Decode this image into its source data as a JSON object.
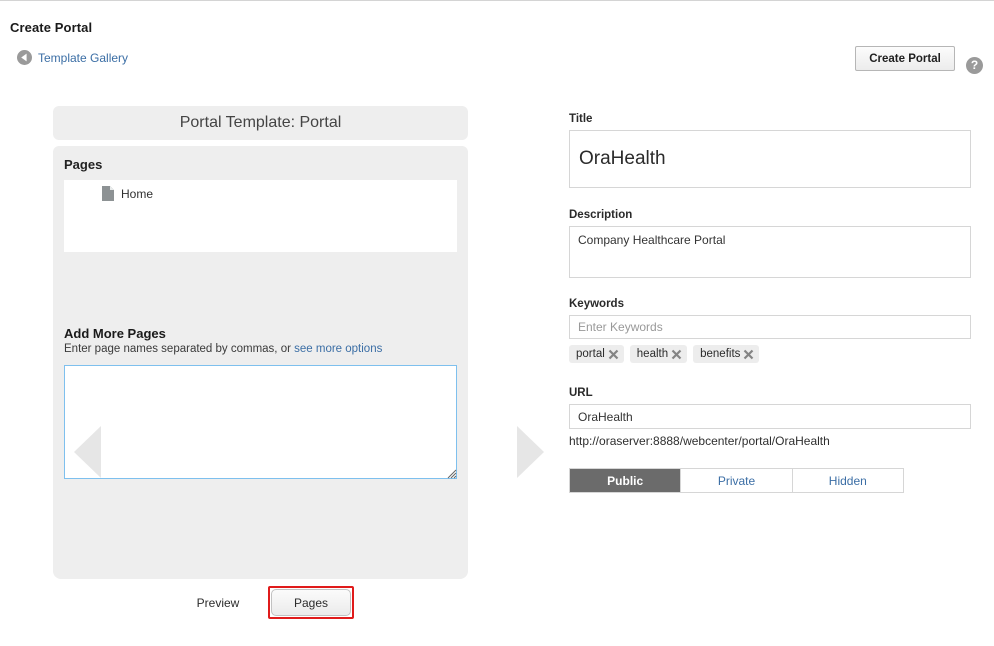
{
  "header": {
    "title": "Create Portal",
    "back_link": "Template Gallery",
    "back_icon": "back-circle-arrow-icon",
    "create_button": "Create Portal",
    "help_icon": "?"
  },
  "template_panel": {
    "title": "Portal Template: Portal",
    "pages_heading": "Pages",
    "pages": [
      {
        "name": "Home",
        "icon": "page-document-icon"
      }
    ],
    "add_more": {
      "heading": "Add More Pages",
      "hint_prefix": "Enter page names separated by commas, or ",
      "hint_link": "see more options",
      "textarea_value": "",
      "textarea_placeholder": ""
    },
    "prev_arrow_icon": "chevron-left-icon",
    "next_arrow_icon": "chevron-right-icon"
  },
  "footer": {
    "preview_button": "Preview",
    "pages_button": "Pages",
    "highlight_color": "#e01b1b"
  },
  "form": {
    "title": {
      "label": "Title",
      "value": "OraHealth"
    },
    "description": {
      "label": "Description",
      "value": "Company Healthcare Portal"
    },
    "keywords": {
      "label": "Keywords",
      "placeholder": "Enter Keywords",
      "value": "",
      "tags": [
        "portal",
        "health",
        "benefits"
      ],
      "remove_icon": "close-x-icon"
    },
    "url": {
      "label": "URL",
      "value": "OraHealth",
      "preview": "http://oraserver:8888/webcenter/portal/OraHealth"
    },
    "visibility": {
      "options": [
        "Public",
        "Private",
        "Hidden"
      ],
      "selected": "Public",
      "selected_bg": "#6b6b6b",
      "link_color": "#3b6ea5"
    }
  }
}
